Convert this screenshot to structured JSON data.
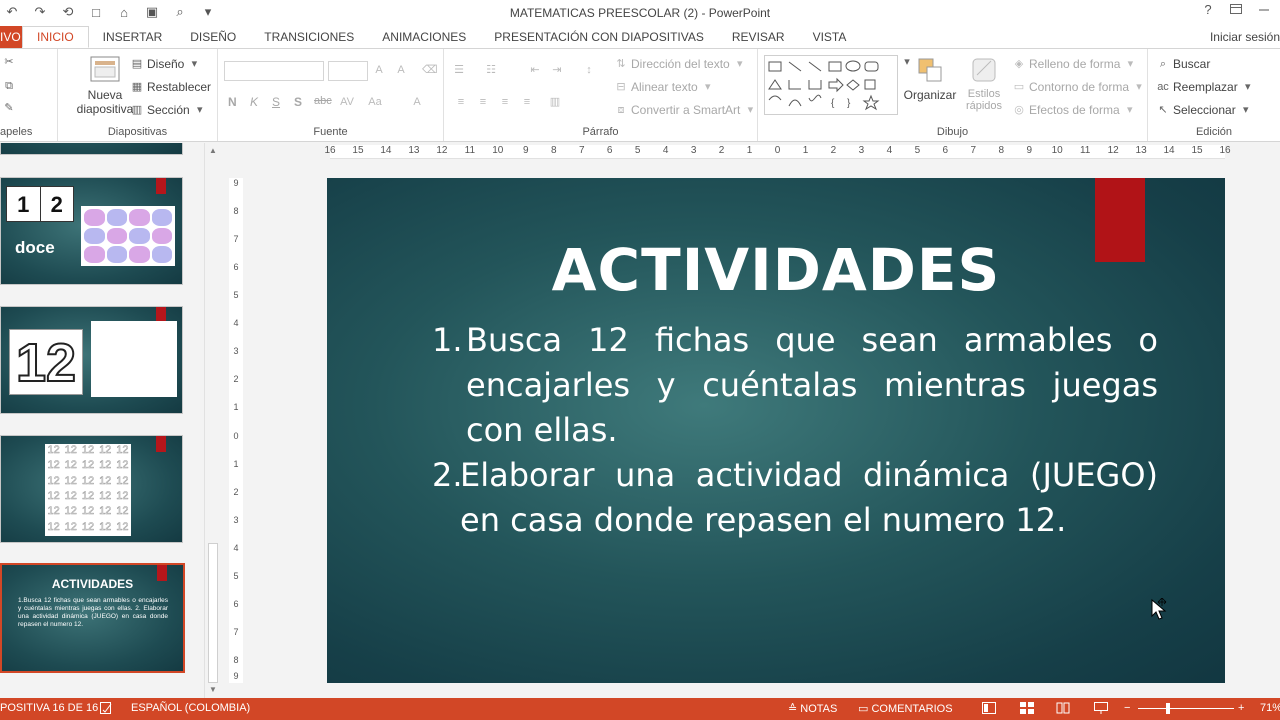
{
  "window": {
    "title": "MATEMATICAS PREESCOLAR (2) - PowerPoint",
    "help": "?",
    "qat": [
      "↶",
      "↷",
      "⟲",
      "□",
      "⌂",
      "▣",
      "⌕",
      "▾"
    ]
  },
  "tabs": {
    "file": "IVO",
    "items": [
      "INICIO",
      "INSERTAR",
      "DISEÑO",
      "TRANSICIONES",
      "ANIMACIONES",
      "PRESENTACIÓN CON DIAPOSITIVAS",
      "REVISAR",
      "VISTA"
    ],
    "signin": "Iniciar sesión"
  },
  "ribbon": {
    "clipboard_label": "apeles",
    "slides": {
      "new_slide_line1": "Nueva",
      "new_slide_line2": "diapositiva",
      "layout": "Diseño",
      "reset": "Restablecer",
      "section": "Sección",
      "label": "Diapositivas"
    },
    "font": {
      "bold": "N",
      "italic": "K",
      "underline": "S",
      "shadow": "S",
      "strike": "abc",
      "label": "Fuente"
    },
    "paragraph": {
      "text_direction": "Dirección del texto",
      "align_text": "Alinear texto",
      "smartart": "Convertir a SmartArt",
      "label": "Párrafo"
    },
    "drawing": {
      "arrange": "Organizar",
      "quick_styles_line1": "Estilos",
      "quick_styles_line2": "rápidos",
      "fill": "Relleno de forma",
      "outline": "Contorno de forma",
      "effects": "Efectos de forma",
      "label": "Dibujo"
    },
    "editing": {
      "find": "Buscar",
      "replace": "Reemplazar",
      "select": "Seleccionar",
      "label": "Edición"
    }
  },
  "thumbnails": {
    "t1_numbers": [
      "1",
      "2"
    ],
    "t1_word": "doce",
    "t2_number": "12",
    "t3_text": "12",
    "t4_title": "ACTIVIDADES",
    "t4_body": "1.Busca 12 fichas que sean armables o encajarles y cuéntalas mientras juegas con ellas. 2. Elaborar una actividad dinámica (JUEGO) en casa donde repasen el numero 12."
  },
  "slide": {
    "title": "ACTIVIDADES",
    "item1_num": "1.",
    "item1_text": "Busca 12 fichas que sean armables o encajarles y cuéntalas mientras juegas con ellas.",
    "item2_num": "2.",
    "item2_text": "Elaborar una actividad dinámica (JUEGO) en casa donde repasen el numero 12."
  },
  "rulers": {
    "h_ticks": [
      "16",
      "15",
      "14",
      "13",
      "12",
      "11",
      "10",
      "9",
      "8",
      "7",
      "6",
      "5",
      "4",
      "3",
      "2",
      "1",
      "0",
      "1",
      "2",
      "3",
      "4",
      "5",
      "6",
      "7",
      "8",
      "9",
      "10",
      "11",
      "12",
      "13",
      "14",
      "15",
      "16"
    ],
    "v_ticks": [
      "9",
      "8",
      "7",
      "6",
      "5",
      "4",
      "3",
      "2",
      "1",
      "0",
      "1",
      "2",
      "3",
      "4",
      "5",
      "6",
      "7",
      "8",
      "9"
    ]
  },
  "status": {
    "slide_count": "POSITIVA 16 DE 16",
    "language": "ESPAÑOL (COLOMBIA)",
    "notes": "NOTAS",
    "comments": "COMENTARIOS",
    "zoom": "71%"
  },
  "colors": {
    "accent": "#d24726",
    "slide_red": "#b11317",
    "slide_teal": "#23555a"
  }
}
